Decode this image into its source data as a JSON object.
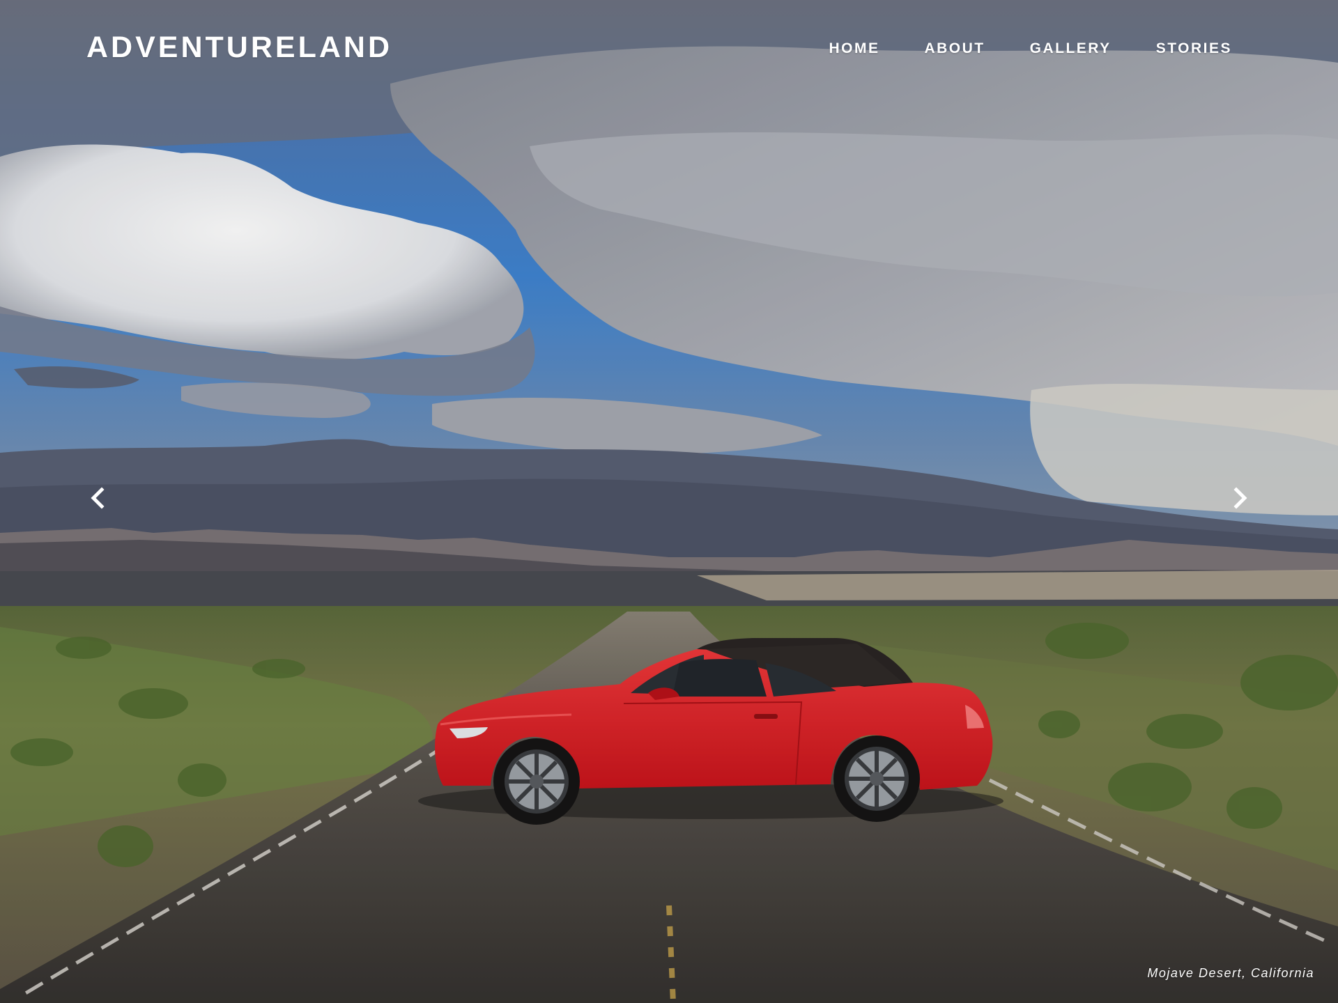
{
  "site": {
    "logo": "ADVENTURELAND"
  },
  "nav": {
    "items": [
      {
        "label": "HOME"
      },
      {
        "label": "ABOUT"
      },
      {
        "label": "GALLERY"
      },
      {
        "label": "STORIES"
      }
    ]
  },
  "slider": {
    "prev_icon": "chevron-left-icon",
    "next_icon": "chevron-right-icon",
    "caption": "Mojave Desert, California"
  },
  "colors": {
    "text": "#ffffff",
    "car": "#e8232a",
    "sky": "#3f7fcf"
  }
}
